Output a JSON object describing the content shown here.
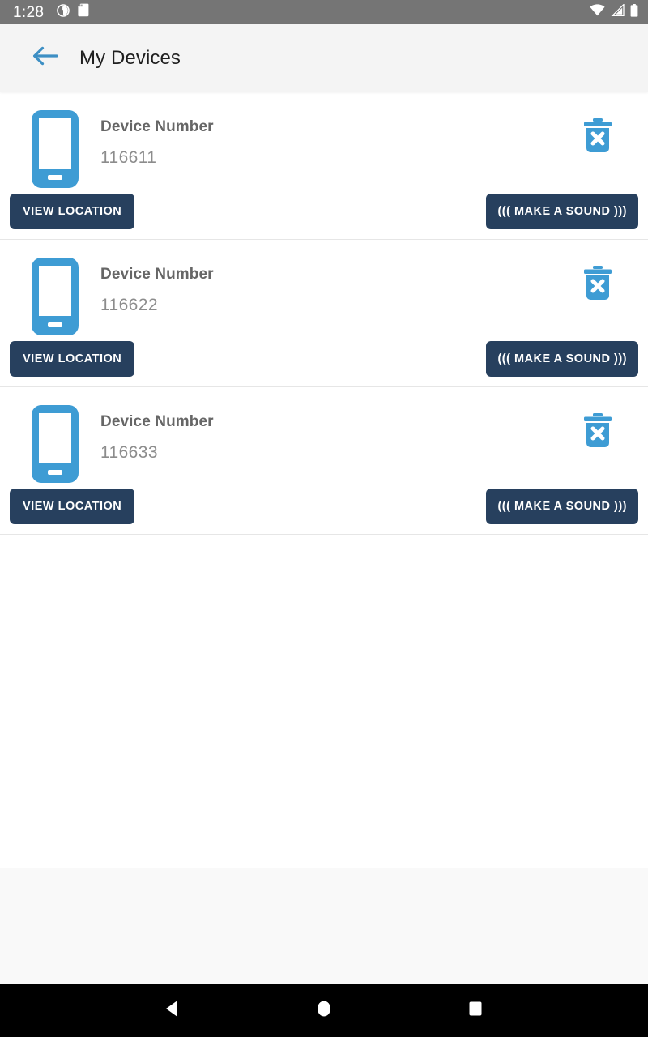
{
  "status_bar": {
    "time": "1:28",
    "left_icons": [
      "do-not-disturb-icon",
      "sd-card-icon"
    ],
    "right_icons": [
      "wifi-icon",
      "cellular-signal-icon",
      "battery-icon"
    ],
    "background_color": "#757575"
  },
  "toolbar": {
    "back_icon": "back-arrow-icon",
    "title": "My Devices",
    "background_color": "#f4f4f4",
    "accent_color": "#3d8fc4"
  },
  "theme": {
    "device_icon_color": "#3e9cd4",
    "delete_icon_color": "#3e9cd4",
    "button_color": "#27405e",
    "button_text_color": "#ffffff",
    "label_color": "#666666",
    "value_color": "#8c8c8c"
  },
  "labels": {
    "device_number_label": "Device Number",
    "view_location": "VIEW LOCATION",
    "make_a_sound": "((( MAKE A SOUND )))",
    "delete_icon": "delete-device-icon",
    "phone_icon": "smartphone-icon"
  },
  "devices": [
    {
      "label": "Device Number",
      "number": "116611",
      "view_location": "VIEW LOCATION",
      "make_sound": "((( MAKE A SOUND )))"
    },
    {
      "label": "Device Number",
      "number": "116622",
      "view_location": "VIEW LOCATION",
      "make_sound": "((( MAKE A SOUND )))"
    },
    {
      "label": "Device Number",
      "number": "116633",
      "view_location": "VIEW LOCATION",
      "make_sound": "((( MAKE A SOUND )))"
    }
  ],
  "nav_bar": {
    "back": "nav-back-icon",
    "home": "nav-home-icon",
    "recents": "nav-recents-icon",
    "background_color": "#000000"
  }
}
